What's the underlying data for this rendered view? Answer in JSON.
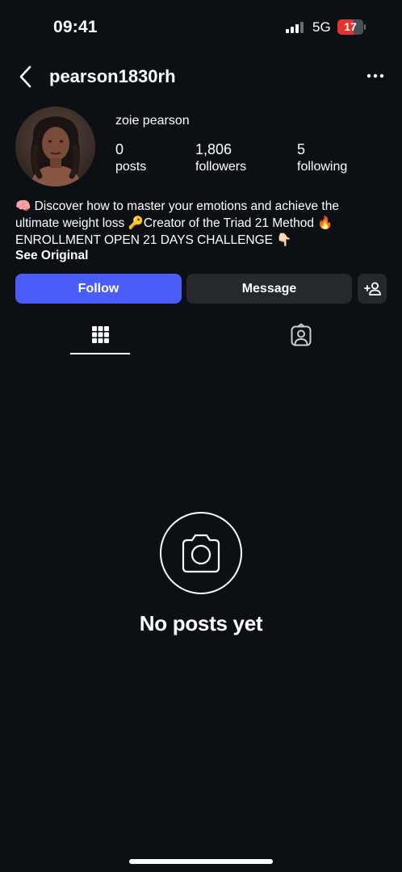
{
  "status_bar": {
    "time": "09:41",
    "network": "5G",
    "battery": "17"
  },
  "header": {
    "username": "pearson1830rh",
    "back_icon": "chevron-left-icon",
    "more_icon": "more-horizontal-icon"
  },
  "profile": {
    "display_name": "zoie pearson",
    "stats": [
      {
        "value": "0",
        "label": "posts"
      },
      {
        "value": "1,806",
        "label": "followers"
      },
      {
        "value": "5",
        "label": "following"
      }
    ],
    "bio_lines": [
      "🧠 Discover how to master your emotions and achieve the",
      "ultimate weight loss 🔑Creator of the Triad 21 Method 🔥",
      "ENROLLMENT OPEN 21 DAYS CHALLENGE 👇🏻"
    ],
    "see_original": "See Original"
  },
  "actions": {
    "follow": "Follow",
    "message": "Message",
    "suggest_icon": "add-person-icon"
  },
  "tabs": [
    {
      "name": "posts-grid",
      "icon": "grid-icon",
      "active": true
    },
    {
      "name": "tagged",
      "icon": "tagged-person-icon",
      "active": false
    }
  ],
  "empty_state": {
    "icon": "camera-icon",
    "title": "No posts yet"
  },
  "colors": {
    "background": "#0c1014",
    "follow_blue": "#4a5df9",
    "secondary_button": "#25292e",
    "battery_low": "#e5322e"
  }
}
